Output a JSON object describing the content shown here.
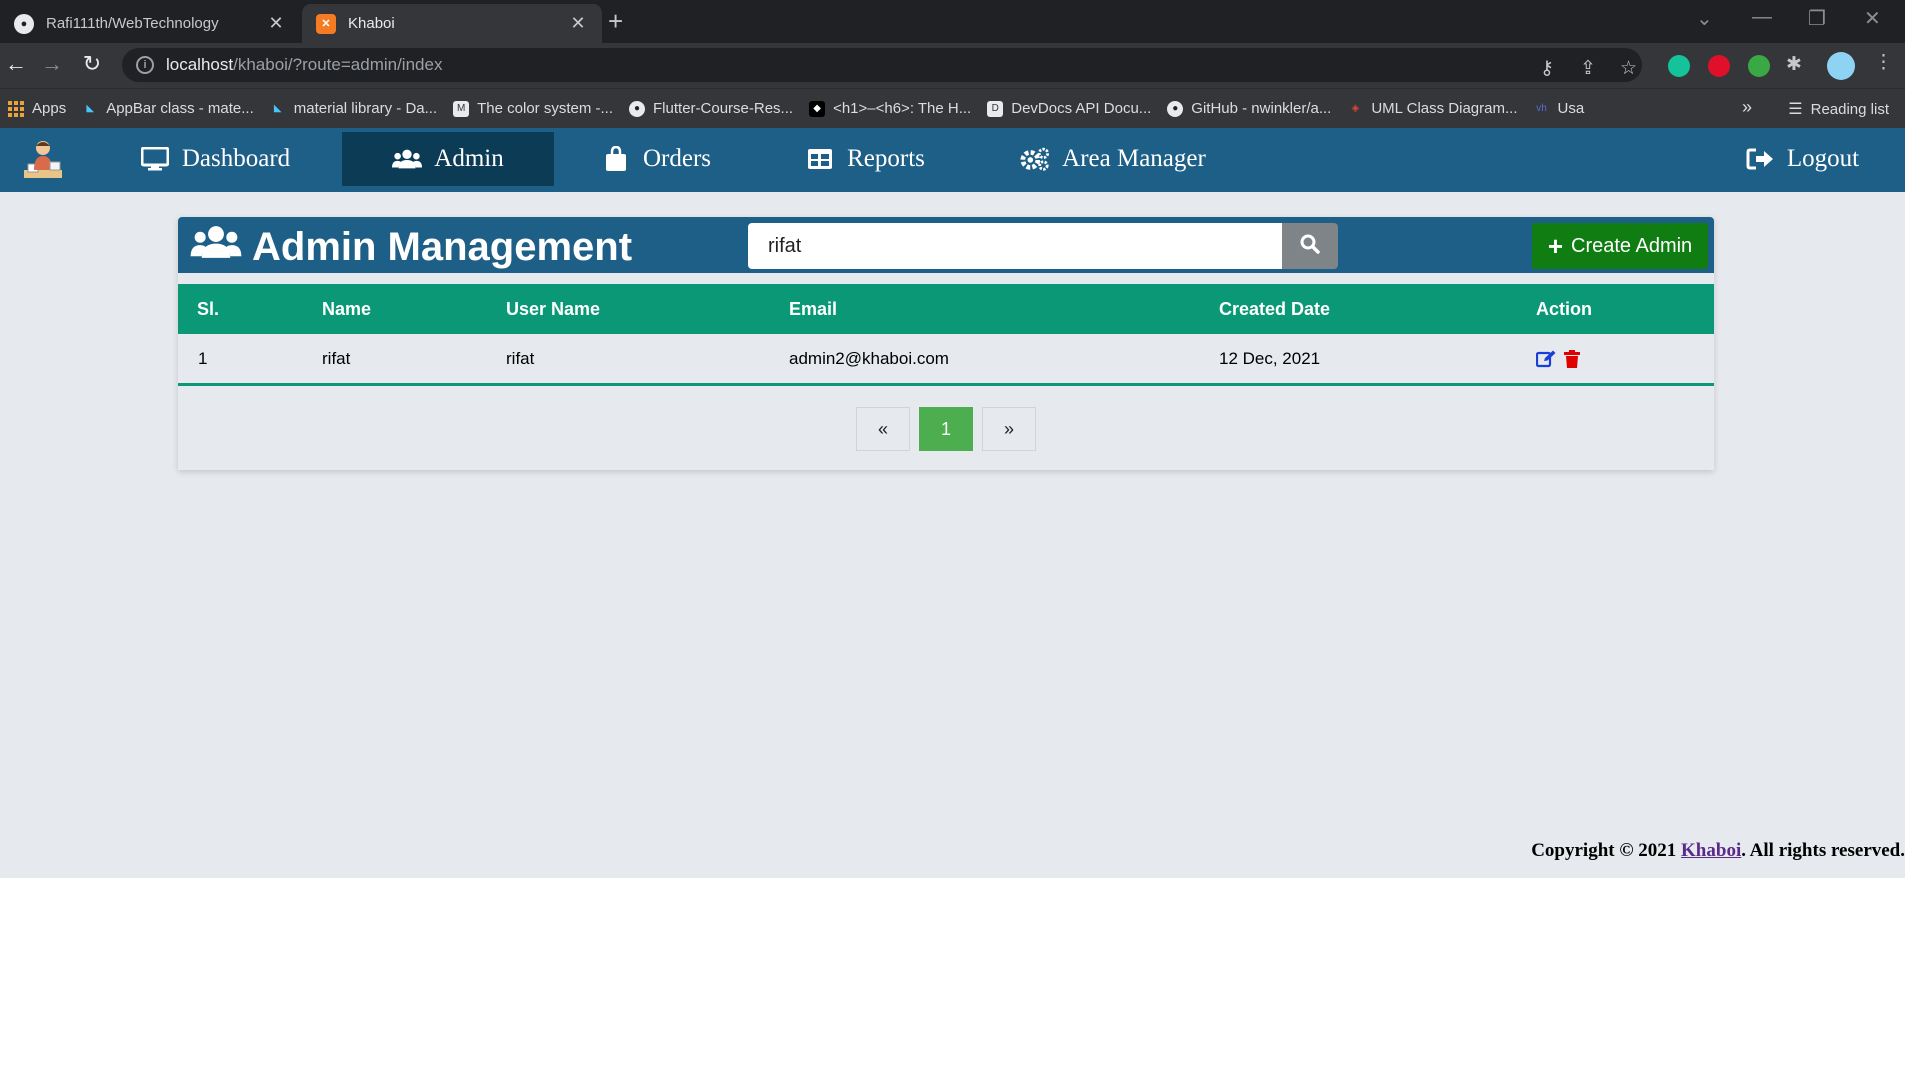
{
  "browser": {
    "tabs": [
      {
        "title": "Rafi111th/WebTechnology",
        "icon": "github-icon",
        "active": false
      },
      {
        "title": "Khaboi",
        "icon": "xampp-icon",
        "active": true
      }
    ],
    "url_host": "localhost",
    "url_path": "/khaboi/?route=admin/index",
    "bookmarks": [
      {
        "label": "Apps",
        "icon": "apps-grid-icon"
      },
      {
        "label": "AppBar class - mate...",
        "icon": "flutter-icon"
      },
      {
        "label": "material library - Da...",
        "icon": "flutter-icon"
      },
      {
        "label": "The color system -...",
        "icon": "material-icon"
      },
      {
        "label": "Flutter-Course-Res...",
        "icon": "github-icon"
      },
      {
        "label": "<h1>–<h6>: The H...",
        "icon": "mdn-icon"
      },
      {
        "label": "DevDocs API Docu...",
        "icon": "devdocs-icon"
      },
      {
        "label": "GitHub - nwinkler/a...",
        "icon": "github-icon"
      },
      {
        "label": "UML Class Diagram...",
        "icon": "visual-paradigm-icon"
      },
      {
        "label": "Usa",
        "icon": "vh-icon"
      }
    ],
    "reading_list": "Reading list",
    "overflow": "»"
  },
  "nav": {
    "items": [
      {
        "label": "Dashboard",
        "icon": "desktop-icon"
      },
      {
        "label": "Admin",
        "icon": "users-icon",
        "active": true
      },
      {
        "label": "Orders",
        "icon": "shopping-bag-icon"
      },
      {
        "label": "Reports",
        "icon": "table-icon"
      },
      {
        "label": "Area Manager",
        "icon": "cogs-icon"
      }
    ],
    "logout": "Logout"
  },
  "admin": {
    "title": "Admin Management",
    "search_value": "rifat",
    "create_label": "Create Admin",
    "columns": [
      "Sl.",
      "Name",
      "User Name",
      "Email",
      "Created Date",
      "Action"
    ],
    "rows": [
      {
        "sl": "1",
        "name": "rifat",
        "username": "rifat",
        "email": "admin2@khaboi.com",
        "created": "12 Dec, 2021"
      }
    ],
    "pagination": {
      "prev": "«",
      "current": "1",
      "next": "»"
    }
  },
  "footer": {
    "prefix": "Copyright © 2021 ",
    "brand": "Khaboi",
    "suffix": ". All rights reserved."
  },
  "colors": {
    "nav_bg": "#1d5f86",
    "nav_active": "#0c3b55",
    "table_header": "#0a9876",
    "create_button": "#0f7d12",
    "page_current": "#4cae4f",
    "edit_icon": "#1a3fd6",
    "delete_icon": "#e00000"
  }
}
